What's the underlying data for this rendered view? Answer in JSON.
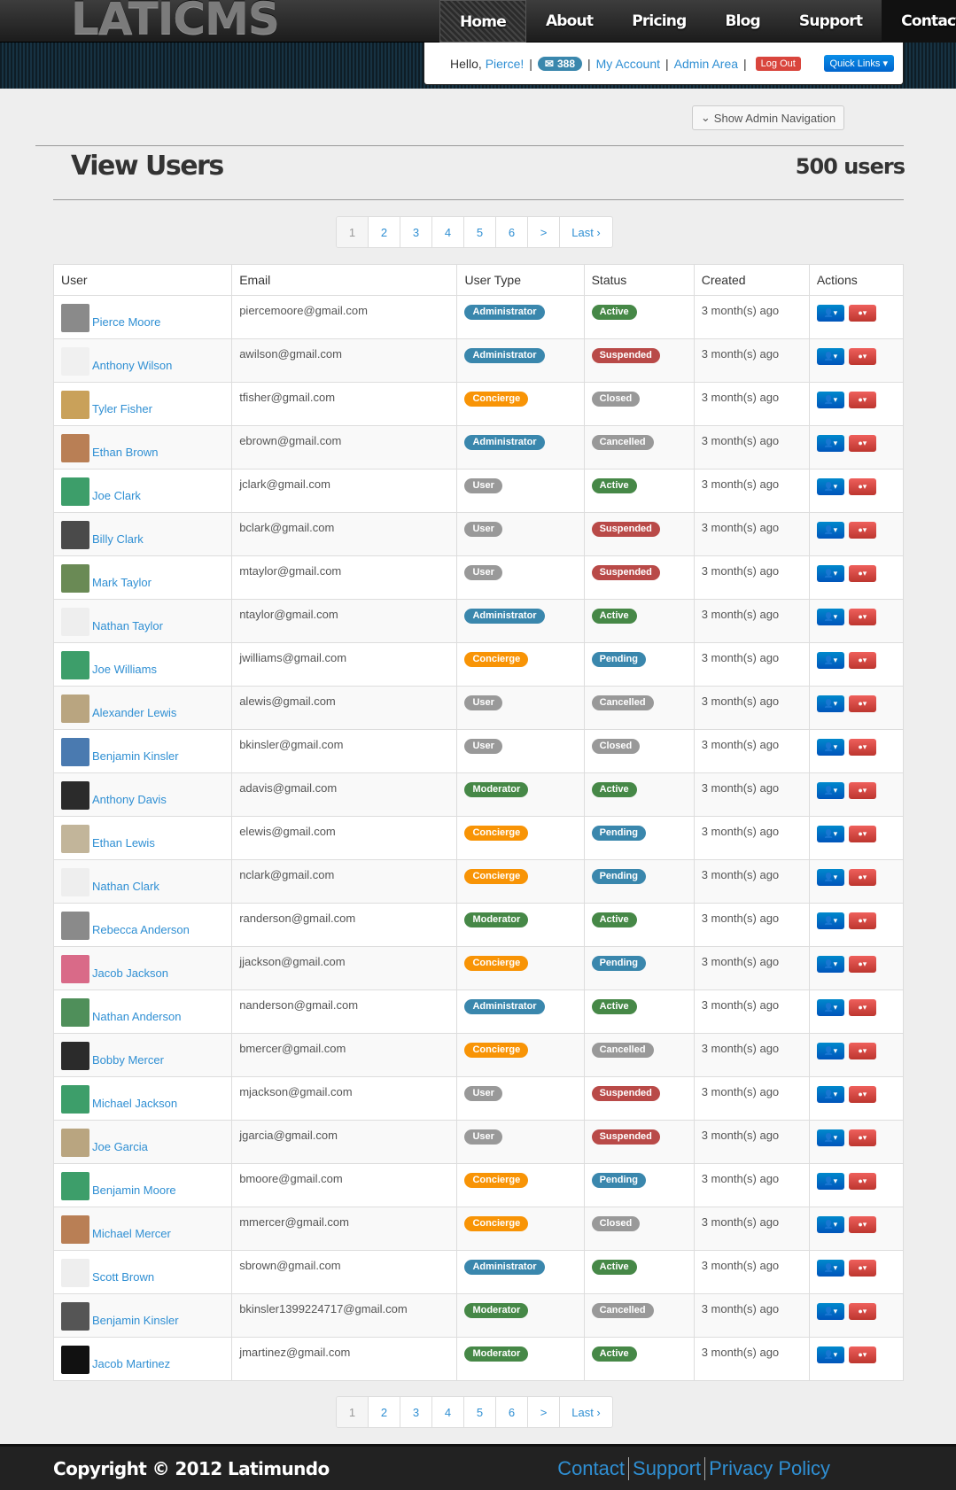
{
  "header": {
    "logo": "LATICMS",
    "nav": [
      "Home",
      "About",
      "Pricing",
      "Blog",
      "Support",
      "Contact"
    ],
    "hello": "Hello,",
    "username": "Pierce!",
    "messages": "388",
    "my_account": "My Account",
    "admin_area": "Admin Area",
    "logout": "Log Out",
    "quick_links": "Quick Links"
  },
  "admin_nav_label": "Show Admin Navigation",
  "page": {
    "title": "View Users",
    "count": "500 users"
  },
  "pagination": {
    "pages": [
      "1",
      "2",
      "3",
      "4",
      "5",
      "6",
      ">",
      "Last ›"
    ],
    "active": "1"
  },
  "table": {
    "headers": [
      "User",
      "Email",
      "User Type",
      "Status",
      "Created",
      "Actions"
    ],
    "rows": [
      {
        "name": "Pierce Moore",
        "email": "piercemoore@gmail.com",
        "type": "Administrator",
        "status": "Active",
        "created": "3 month(s) ago"
      },
      {
        "name": "Anthony Wilson",
        "email": "awilson@gmail.com",
        "type": "Administrator",
        "status": "Suspended",
        "created": "3 month(s) ago"
      },
      {
        "name": "Tyler Fisher",
        "email": "tfisher@gmail.com",
        "type": "Concierge",
        "status": "Closed",
        "created": "3 month(s) ago"
      },
      {
        "name": "Ethan Brown",
        "email": "ebrown@gmail.com",
        "type": "Administrator",
        "status": "Cancelled",
        "created": "3 month(s) ago"
      },
      {
        "name": "Joe Clark",
        "email": "jclark@gmail.com",
        "type": "User",
        "status": "Active",
        "created": "3 month(s) ago"
      },
      {
        "name": "Billy Clark",
        "email": "bclark@gmail.com",
        "type": "User",
        "status": "Suspended",
        "created": "3 month(s) ago"
      },
      {
        "name": "Mark Taylor",
        "email": "mtaylor@gmail.com",
        "type": "User",
        "status": "Suspended",
        "created": "3 month(s) ago"
      },
      {
        "name": "Nathan Taylor",
        "email": "ntaylor@gmail.com",
        "type": "Administrator",
        "status": "Active",
        "created": "3 month(s) ago"
      },
      {
        "name": "Joe Williams",
        "email": "jwilliams@gmail.com",
        "type": "Concierge",
        "status": "Pending",
        "created": "3 month(s) ago"
      },
      {
        "name": "Alexander Lewis",
        "email": "alewis@gmail.com",
        "type": "User",
        "status": "Cancelled",
        "created": "3 month(s) ago"
      },
      {
        "name": "Benjamin Kinsler",
        "email": "bkinsler@gmail.com",
        "type": "User",
        "status": "Closed",
        "created": "3 month(s) ago"
      },
      {
        "name": "Anthony Davis",
        "email": "adavis@gmail.com",
        "type": "Moderator",
        "status": "Active",
        "created": "3 month(s) ago"
      },
      {
        "name": "Ethan Lewis",
        "email": "elewis@gmail.com",
        "type": "Concierge",
        "status": "Pending",
        "created": "3 month(s) ago"
      },
      {
        "name": "Nathan Clark",
        "email": "nclark@gmail.com",
        "type": "Concierge",
        "status": "Pending",
        "created": "3 month(s) ago"
      },
      {
        "name": "Rebecca Anderson",
        "email": "randerson@gmail.com",
        "type": "Moderator",
        "status": "Active",
        "created": "3 month(s) ago"
      },
      {
        "name": "Jacob Jackson",
        "email": "jjackson@gmail.com",
        "type": "Concierge",
        "status": "Pending",
        "created": "3 month(s) ago"
      },
      {
        "name": "Nathan Anderson",
        "email": "nanderson@gmail.com",
        "type": "Administrator",
        "status": "Active",
        "created": "3 month(s) ago"
      },
      {
        "name": "Bobby Mercer",
        "email": "bmercer@gmail.com",
        "type": "Concierge",
        "status": "Cancelled",
        "created": "3 month(s) ago"
      },
      {
        "name": "Michael Jackson",
        "email": "mjackson@gmail.com",
        "type": "User",
        "status": "Suspended",
        "created": "3 month(s) ago"
      },
      {
        "name": "Joe Garcia",
        "email": "jgarcia@gmail.com",
        "type": "User",
        "status": "Suspended",
        "created": "3 month(s) ago"
      },
      {
        "name": "Benjamin Moore",
        "email": "bmoore@gmail.com",
        "type": "Concierge",
        "status": "Pending",
        "created": "3 month(s) ago"
      },
      {
        "name": "Michael Mercer",
        "email": "mmercer@gmail.com",
        "type": "Concierge",
        "status": "Closed",
        "created": "3 month(s) ago"
      },
      {
        "name": "Scott Brown",
        "email": "sbrown@gmail.com",
        "type": "Administrator",
        "status": "Active",
        "created": "3 month(s) ago"
      },
      {
        "name": "Benjamin Kinsler",
        "email": "bkinsler1399224717@gmail.com",
        "type": "Moderator",
        "status": "Cancelled",
        "created": "3 month(s) ago"
      },
      {
        "name": "Jacob Martinez",
        "email": "jmartinez@gmail.com",
        "type": "Moderator",
        "status": "Active",
        "created": "3 month(s) ago"
      }
    ]
  },
  "type_colors": {
    "Administrator": "#3a87ad",
    "Concierge": "#f89406",
    "User": "#999999",
    "Moderator": "#468847"
  },
  "status_colors": {
    "Active": "#468847",
    "Suspended": "#b94a48",
    "Closed": "#999999",
    "Cancelled": "#999999",
    "Pending": "#3a87ad"
  },
  "footer": {
    "copyright": "Copyright © 2012 Latimundo",
    "links": [
      "Contact",
      "Support",
      "Privacy Policy"
    ]
  }
}
